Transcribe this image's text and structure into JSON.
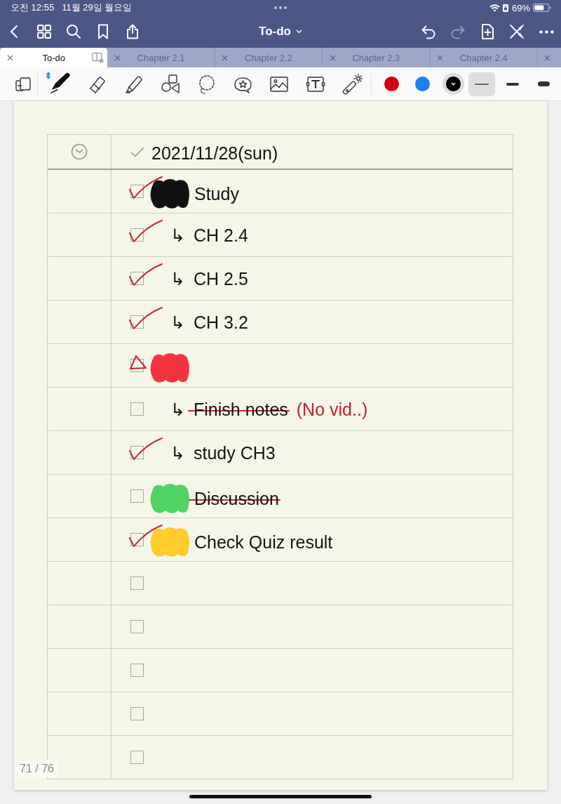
{
  "status_bar": {
    "time": "오전 12:55",
    "date": "11월 29일 월요일",
    "battery": "69%"
  },
  "nav": {
    "title": "To-do",
    "left": [
      {
        "kind": "back"
      },
      {
        "kind": "grid"
      },
      {
        "kind": "search"
      },
      {
        "kind": "bookmark"
      },
      {
        "kind": "share"
      }
    ],
    "right": [
      {
        "kind": "undo",
        "disabled": false
      },
      {
        "kind": "redo",
        "disabled": true
      },
      {
        "kind": "add_page",
        "disabled": false
      },
      {
        "kind": "pen_off",
        "disabled": false
      },
      {
        "kind": "more",
        "disabled": false
      }
    ]
  },
  "tabs": [
    {
      "label": "To-do",
      "selected": true
    },
    {
      "label": "Chapter 2.1",
      "selected": false
    },
    {
      "label": "Chapter 2.2",
      "selected": false
    },
    {
      "label": "Chapter 2.3",
      "selected": false
    },
    {
      "label": "Chapter 2.4",
      "selected": false
    },
    {
      "selected": false
    }
  ],
  "toolbar": {
    "tools": [
      {
        "kind": "pen",
        "selected": true
      },
      {
        "kind": "eraser",
        "selected": false
      },
      {
        "kind": "highlighter",
        "selected": false
      },
      {
        "kind": "shapes",
        "selected": false
      },
      {
        "kind": "lasso",
        "selected": false
      },
      {
        "kind": "sticker",
        "selected": false
      },
      {
        "kind": "image",
        "selected": false
      },
      {
        "kind": "text",
        "selected": false
      },
      {
        "kind": "laser",
        "selected": false
      }
    ],
    "colors": [
      {
        "color": "#d0020f",
        "selected": false
      },
      {
        "color": "#1a7ff5",
        "selected": false
      },
      {
        "color": "#000000",
        "selected": true
      }
    ],
    "widths": [
      {
        "kind": "thin",
        "selected": true
      },
      {
        "kind": "medium",
        "selected": false
      },
      {
        "kind": "thick",
        "selected": false
      }
    ]
  },
  "page": {
    "date": "2021/11/28(sun)",
    "rows": [
      {
        "checked": true,
        "partial": false,
        "scribble": {
          "color": "#111111"
        },
        "text": "Study",
        "struck": false
      },
      {
        "checked": true,
        "partial": false,
        "prefix": "↳",
        "text": "CH 2.4",
        "struck": false
      },
      {
        "checked": true,
        "partial": false,
        "prefix": "↳",
        "text": "CH 2.5",
        "struck": false
      },
      {
        "checked": true,
        "partial": false,
        "prefix": "↳",
        "text": "CH 3.2",
        "struck": false
      },
      {
        "checked": false,
        "partial": true,
        "scribble": {
          "color": "#f5333f"
        }
      },
      {
        "checked": false,
        "partial": false,
        "prefix": "↳",
        "text": "Finish notes",
        "struck": true,
        "note": "(No vid..)"
      },
      {
        "checked": true,
        "partial": false,
        "prefix": "↳",
        "text": "study CH3",
        "struck": false
      },
      {
        "checked": false,
        "partial": false,
        "scribble": {
          "color": "#4fd365"
        },
        "text": "Discussion",
        "struck": true
      },
      {
        "checked": true,
        "partial": false,
        "scribble": {
          "color": "#ffcc2e"
        },
        "text": "Check Quiz result",
        "struck": false
      },
      {
        "checked": false,
        "partial": false
      },
      {
        "checked": false,
        "partial": false
      },
      {
        "checked": false,
        "partial": false
      },
      {
        "checked": false,
        "partial": false
      },
      {
        "checked": false,
        "partial": false
      }
    ],
    "page_number": "71 / 76"
  }
}
